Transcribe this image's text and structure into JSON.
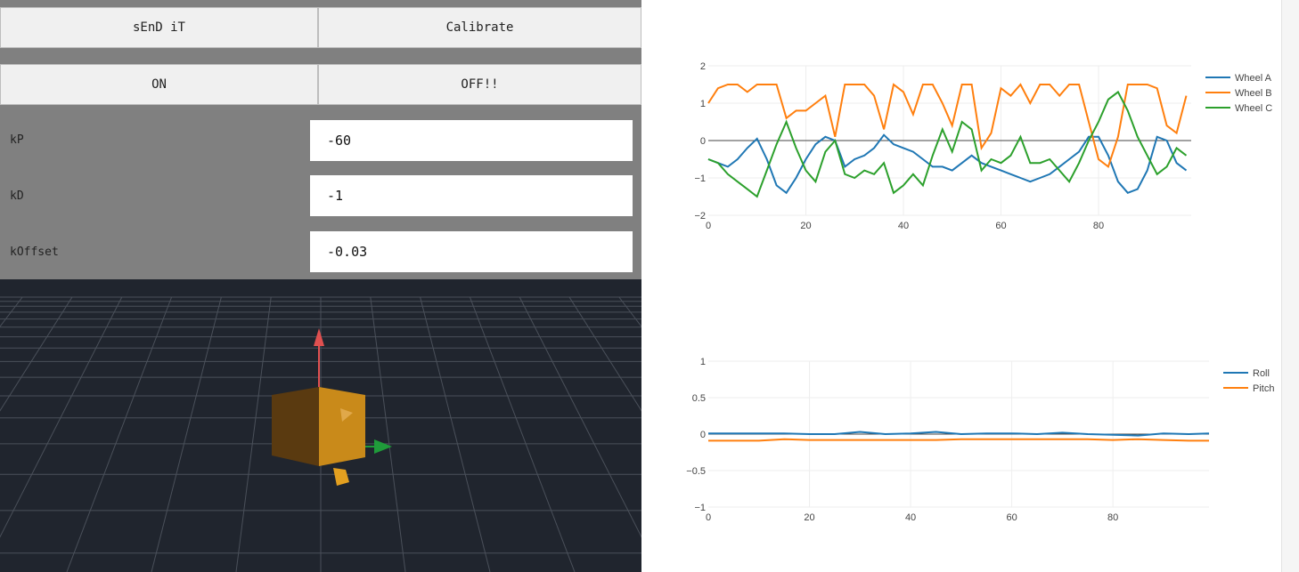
{
  "controls": {
    "send_label": "sEnD iT",
    "calibrate_label": "Calibrate",
    "on_label": "ON",
    "off_label": "OFF!!"
  },
  "params": [
    {
      "name": "kP",
      "value": "-60"
    },
    {
      "name": "kD",
      "value": "-1"
    },
    {
      "name": "kOffset",
      "value": "-0.03"
    }
  ],
  "colors": {
    "panel_bg": "#808080",
    "button_bg": "#f0f0f0",
    "viewport_bg": "#20252e",
    "cube": "#c98a1a",
    "axis_up": "#e05050",
    "axis_right": "#1f9b3a",
    "series_blue": "#1f77b4",
    "series_orange": "#ff7f0e",
    "series_green": "#2ca02c"
  },
  "chart_data": [
    {
      "type": "line",
      "xlim": [
        0,
        99
      ],
      "ylim": [
        -2,
        2
      ],
      "xticks": [
        "0",
        "20",
        "40",
        "60",
        "80"
      ],
      "yticks": [
        "2",
        "1",
        "0",
        "−1",
        "−2"
      ],
      "legend": "top-right",
      "series": [
        {
          "name": "Wheel A",
          "color": "#1f77b4",
          "x": [
            0,
            2,
            4,
            6,
            8,
            10,
            12,
            14,
            16,
            18,
            20,
            22,
            24,
            26,
            28,
            30,
            32,
            34,
            36,
            38,
            40,
            42,
            44,
            46,
            48,
            50,
            52,
            54,
            56,
            58,
            60,
            62,
            64,
            66,
            68,
            70,
            72,
            74,
            76,
            78,
            80,
            82,
            84,
            86,
            88,
            90,
            92,
            94,
            96,
            98
          ],
          "y": [
            -0.5,
            -0.6,
            -0.7,
            -0.5,
            -0.2,
            0.05,
            -0.5,
            -1.2,
            -1.4,
            -1.0,
            -0.5,
            -0.1,
            0.1,
            0.0,
            -0.7,
            -0.5,
            -0.4,
            -0.2,
            0.15,
            -0.1,
            -0.2,
            -0.3,
            -0.5,
            -0.7,
            -0.7,
            -0.8,
            -0.6,
            -0.4,
            -0.6,
            -0.7,
            -0.8,
            -0.9,
            -1.0,
            -1.1,
            -1.0,
            -0.9,
            -0.7,
            -0.5,
            -0.3,
            0.1,
            0.1,
            -0.4,
            -1.1,
            -1.4,
            -1.3,
            -0.8,
            0.1,
            0.0,
            -0.6,
            -0.8
          ]
        },
        {
          "name": "Wheel B",
          "color": "#ff7f0e",
          "x": [
            0,
            2,
            4,
            6,
            8,
            10,
            12,
            14,
            16,
            18,
            20,
            22,
            24,
            26,
            28,
            30,
            32,
            34,
            36,
            38,
            40,
            42,
            44,
            46,
            48,
            50,
            52,
            54,
            56,
            58,
            60,
            62,
            64,
            66,
            68,
            70,
            72,
            74,
            76,
            78,
            80,
            82,
            84,
            86,
            88,
            90,
            92,
            94,
            96,
            98
          ],
          "y": [
            1.0,
            1.4,
            1.5,
            1.5,
            1.3,
            1.5,
            1.5,
            1.5,
            0.6,
            0.8,
            0.8,
            1.0,
            1.2,
            0.1,
            1.5,
            1.5,
            1.5,
            1.2,
            0.3,
            1.5,
            1.3,
            0.7,
            1.5,
            1.5,
            1.0,
            0.4,
            1.5,
            1.5,
            -0.2,
            0.2,
            1.4,
            1.2,
            1.5,
            1.0,
            1.5,
            1.5,
            1.2,
            1.5,
            1.5,
            0.5,
            -0.5,
            -0.7,
            0.1,
            1.5,
            1.5,
            1.5,
            1.4,
            0.4,
            0.2,
            1.2
          ]
        },
        {
          "name": "Wheel C",
          "color": "#2ca02c",
          "x": [
            0,
            2,
            4,
            6,
            8,
            10,
            12,
            14,
            16,
            18,
            20,
            22,
            24,
            26,
            28,
            30,
            32,
            34,
            36,
            38,
            40,
            42,
            44,
            46,
            48,
            50,
            52,
            54,
            56,
            58,
            60,
            62,
            64,
            66,
            68,
            70,
            72,
            74,
            76,
            78,
            80,
            82,
            84,
            86,
            88,
            90,
            92,
            94,
            96,
            98
          ],
          "y": [
            -0.5,
            -0.6,
            -0.9,
            -1.1,
            -1.3,
            -1.5,
            -0.8,
            -0.1,
            0.5,
            -0.2,
            -0.8,
            -1.1,
            -0.3,
            0.0,
            -0.9,
            -1.0,
            -0.8,
            -0.9,
            -0.6,
            -1.4,
            -1.2,
            -0.9,
            -1.2,
            -0.4,
            0.3,
            -0.3,
            0.5,
            0.3,
            -0.8,
            -0.5,
            -0.6,
            -0.4,
            0.1,
            -0.6,
            -0.6,
            -0.5,
            -0.8,
            -1.1,
            -0.6,
            0.0,
            0.5,
            1.1,
            1.3,
            0.8,
            0.1,
            -0.4,
            -0.9,
            -0.7,
            -0.2,
            -0.4
          ]
        }
      ]
    },
    {
      "type": "line",
      "xlim": [
        0,
        99
      ],
      "ylim": [
        -1,
        1
      ],
      "xticks": [
        "0",
        "20",
        "40",
        "60",
        "80"
      ],
      "yticks": [
        "1",
        "0.5",
        "0",
        "−0.5",
        "−1"
      ],
      "legend": "top-right",
      "series": [
        {
          "name": "Roll",
          "color": "#1f77b4",
          "x": [
            0,
            5,
            10,
            15,
            20,
            25,
            30,
            35,
            40,
            45,
            50,
            55,
            60,
            65,
            70,
            75,
            80,
            85,
            90,
            95,
            99
          ],
          "y": [
            0.01,
            0.01,
            0.01,
            0.01,
            0.0,
            0.0,
            0.03,
            0.0,
            0.01,
            0.03,
            0.0,
            0.01,
            0.01,
            0.0,
            0.02,
            0.0,
            -0.01,
            -0.02,
            0.01,
            0.0,
            0.01
          ]
        },
        {
          "name": "Pitch",
          "color": "#ff7f0e",
          "x": [
            0,
            5,
            10,
            15,
            20,
            25,
            30,
            35,
            40,
            45,
            50,
            55,
            60,
            65,
            70,
            75,
            80,
            85,
            90,
            95,
            99
          ],
          "y": [
            -0.09,
            -0.09,
            -0.09,
            -0.07,
            -0.08,
            -0.08,
            -0.08,
            -0.08,
            -0.08,
            -0.08,
            -0.07,
            -0.07,
            -0.07,
            -0.07,
            -0.07,
            -0.07,
            -0.08,
            -0.07,
            -0.08,
            -0.09,
            -0.09
          ]
        }
      ]
    }
  ]
}
